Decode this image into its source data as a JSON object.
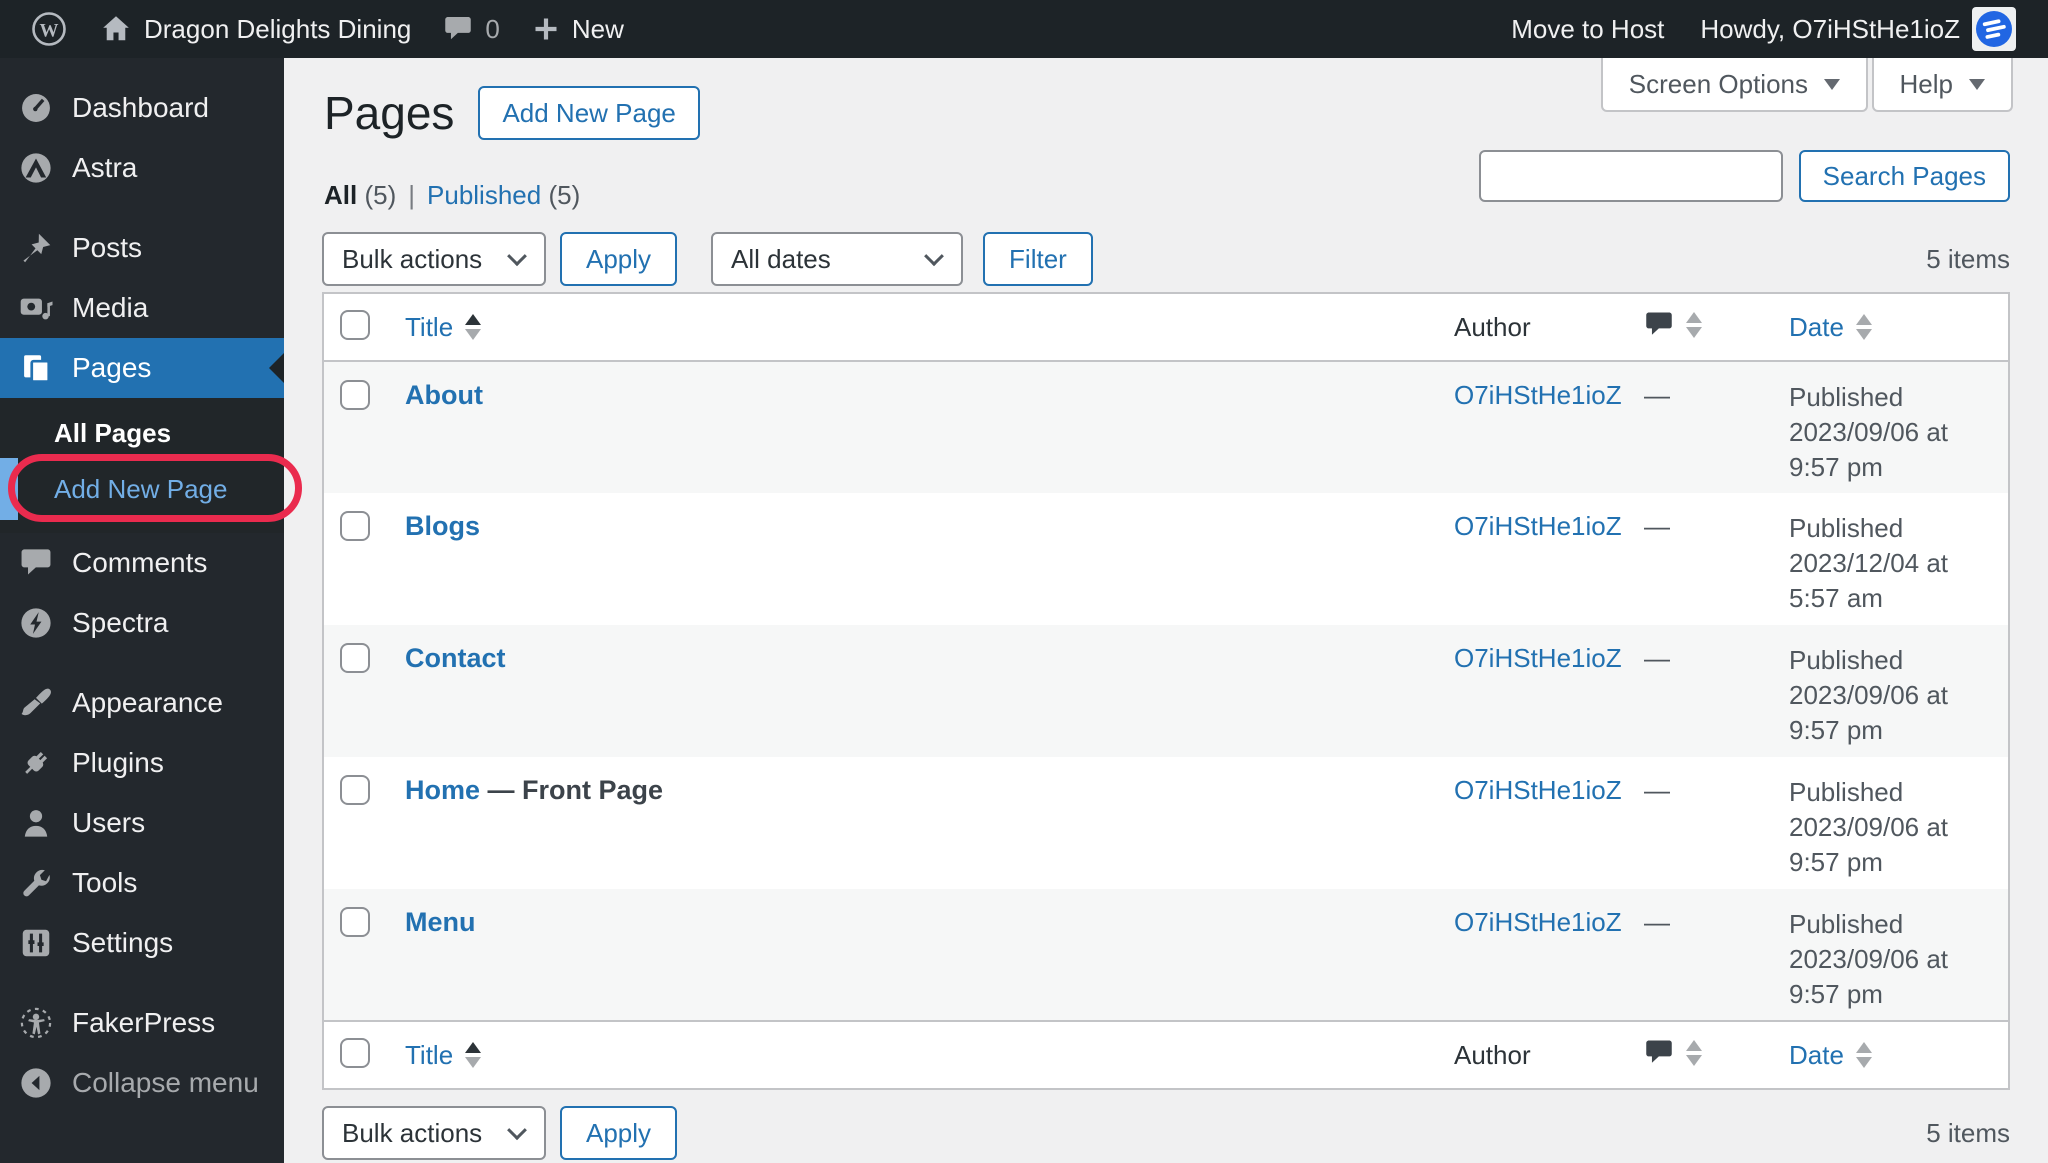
{
  "admin_bar": {
    "site_name": "Dragon Delights Dining",
    "comments_count": "0",
    "new_label": "New",
    "move_to_host": "Move to Host",
    "howdy": "Howdy, O7iHStHe1ioZ"
  },
  "sidebar": {
    "items": [
      {
        "label": "Dashboard",
        "icon": "dashboard-icon"
      },
      {
        "label": "Astra",
        "icon": "astra-icon"
      },
      {
        "label": "Posts",
        "icon": "pushpin-icon"
      },
      {
        "label": "Media",
        "icon": "media-icon"
      },
      {
        "label": "Pages",
        "icon": "pages-icon"
      },
      {
        "label": "Comments",
        "icon": "comment-icon"
      },
      {
        "label": "Spectra",
        "icon": "spectra-icon"
      },
      {
        "label": "Appearance",
        "icon": "brush-icon"
      },
      {
        "label": "Plugins",
        "icon": "plugin-icon"
      },
      {
        "label": "Users",
        "icon": "user-icon"
      },
      {
        "label": "Tools",
        "icon": "wrench-icon"
      },
      {
        "label": "Settings",
        "icon": "settings-icon"
      },
      {
        "label": "FakerPress",
        "icon": "fakerpress-icon"
      },
      {
        "label": "Collapse menu",
        "icon": "collapse-icon"
      }
    ],
    "submenu": {
      "all_pages": "All Pages",
      "add_new_page": "Add New Page"
    }
  },
  "page_header": {
    "title": "Pages",
    "add_new_button": "Add New Page",
    "screen_options": "Screen Options",
    "help": "Help"
  },
  "views": {
    "all": "All",
    "all_count": "(5)",
    "separator": "|",
    "published": "Published",
    "published_count": "(5)"
  },
  "toolbar": {
    "bulk_actions": "Bulk actions",
    "apply": "Apply",
    "all_dates": "All dates",
    "filter": "Filter",
    "search_button": "Search Pages",
    "items_count": "5 items"
  },
  "table": {
    "headers": {
      "title": "Title",
      "author": "Author",
      "date": "Date"
    },
    "rows": [
      {
        "title": "About",
        "suffix": "",
        "author": "O7iHStHe1ioZ",
        "comments": "—",
        "date": [
          "Published",
          "2023/09/06 at",
          "9:57 pm"
        ]
      },
      {
        "title": "Blogs",
        "suffix": "",
        "author": "O7iHStHe1ioZ",
        "comments": "—",
        "date": [
          "Published",
          "2023/12/04 at",
          "5:57 am"
        ]
      },
      {
        "title": "Contact",
        "suffix": "",
        "author": "O7iHStHe1ioZ",
        "comments": "—",
        "date": [
          "Published",
          "2023/09/06 at",
          "9:57 pm"
        ]
      },
      {
        "title": "Home",
        "suffix": " — Front Page",
        "author": "O7iHStHe1ioZ",
        "comments": "—",
        "date": [
          "Published",
          "2023/09/06 at",
          "9:57 pm"
        ]
      },
      {
        "title": "Menu",
        "suffix": "",
        "author": "O7iHStHe1ioZ",
        "comments": "—",
        "date": [
          "Published",
          "2023/09/06 at",
          "9:57 pm"
        ]
      }
    ]
  },
  "colors": {
    "accent_blue": "#2271b1",
    "light_blue": "#72aee6",
    "annotation_red": "#ea2b4e",
    "admin_bar_bg": "#1d2327",
    "sidebar_bg": "#23282d",
    "selected_menu": "#2271b1",
    "content_bg": "#f0f0f1",
    "stripe_row": "#f6f7f7"
  }
}
